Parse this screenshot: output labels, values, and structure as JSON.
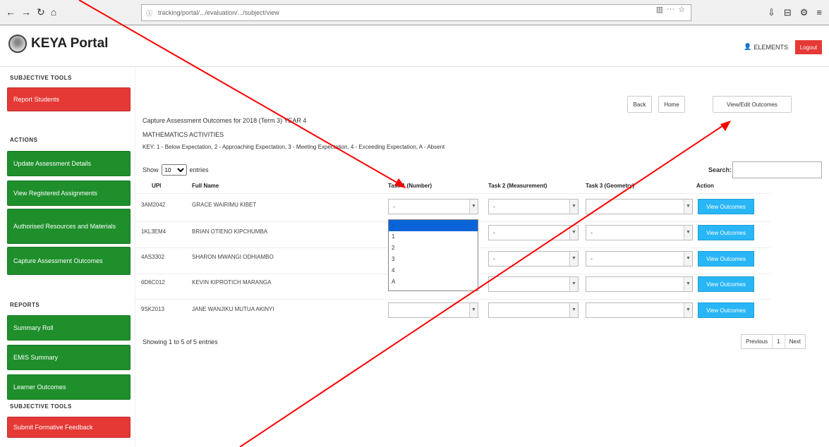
{
  "browser": {
    "nav": [
      "←",
      "→",
      "↻",
      "⌂"
    ],
    "url": "tracking/portal/.../evaluation/.../subject/view",
    "url_actions": [
      "▥",
      "···",
      "☆"
    ],
    "right_icons": [
      "⇩",
      "⊟",
      "⚙",
      "≡"
    ]
  },
  "header": {
    "app_title": "KEYA Portal",
    "user": "ELEMENTS",
    "logout": "Logout"
  },
  "sidebar": {
    "section_1": "SUBJECTIVE TOOLS",
    "btn_1": "Report Students",
    "section_2": "ACTIONS",
    "btn_2": "Update Assessment Details",
    "btn_3": "View Registered Assignments",
    "btn_4": "Authorised Resources and Materials",
    "btn_5": "Capture Assessment Outcomes",
    "section_3": "REPORTS",
    "btn_6": "Summary Roll",
    "btn_7": "EMIS Summary",
    "btn_8": "Learner Outcomes",
    "section_4": "SUBJECTIVE TOOLS",
    "btn_9": "Submit Formative Feedback"
  },
  "main": {
    "line1": "Capture Assessment Outcomes for 2018 (Term 3) YEAR 4",
    "line2": "MATHEMATICS ACTIVITIES",
    "line3": "KEY: 1 - Below Expectation, 2 - Approaching Expectation, 3 - Meeting Expectation, 4 - Exceeding Expectation, A - Absent",
    "buttons": {
      "back": "Back",
      "home": "Home",
      "view_all": "View/Edit Outcomes"
    },
    "show_label": "Show",
    "show_value": "10",
    "entries_label": "entries",
    "search_label": "Search:",
    "columns": [
      "UPI",
      "Full Name",
      "Task 1 (Number)",
      "Task 2 (Measurement)",
      "Task 3 (Geometry)",
      "Action"
    ],
    "rows": [
      {
        "upi": "3AM2042",
        "name": "GRACE WAIRIMU KIBET"
      },
      {
        "upi": "1KL3EM4",
        "name": "BRIAN OTIENO KIPCHUMBA"
      },
      {
        "upi": "4AS3302",
        "name": "SHARON MWANGI ODHIAMBO"
      },
      {
        "upi": "6D6C012",
        "name": "KEVIN KIPROTICH MARANGA"
      },
      {
        "upi": "9SK2013",
        "name": "JANE WANJIKU MUTUA AKINYI"
      }
    ],
    "dd_default": "-",
    "dd_options": [
      "-",
      "1",
      "2",
      "3",
      "4",
      "A"
    ],
    "action_label": "View Outcomes",
    "showing": "Showing 1 to 5 of 5 entries",
    "pager": [
      "Previous",
      "1",
      "Next"
    ]
  },
  "colors": {
    "red": "#e53935",
    "green": "#1e8f2b",
    "blue": "#29b6f6",
    "annotation": "#ff0000"
  }
}
